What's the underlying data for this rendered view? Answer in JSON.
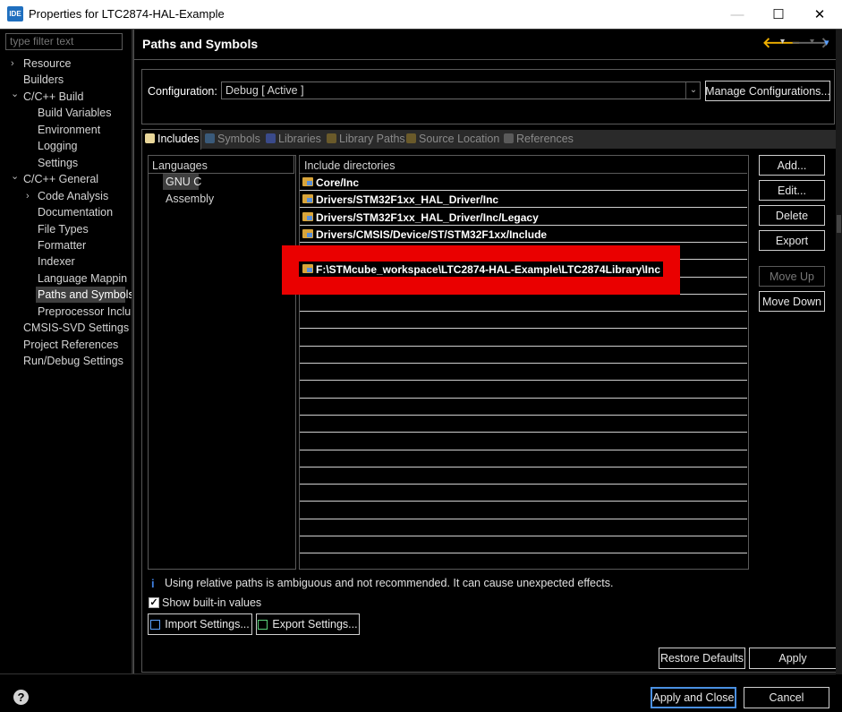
{
  "window": {
    "app_icon_text": "IDE",
    "title": "Properties for LTC2874-HAL-Example",
    "minimize": "—",
    "maximize": "☐",
    "close": "✕"
  },
  "sidebar": {
    "filter_placeholder": "type filter text",
    "items": [
      {
        "label": "Resource",
        "arrow": "›"
      },
      {
        "label": "Builders",
        "arrow": ""
      },
      {
        "label": "C/C++ Build",
        "arrow": "⌄"
      },
      {
        "label": "Build Variables",
        "arrow": ""
      },
      {
        "label": "Environment",
        "arrow": ""
      },
      {
        "label": "Logging",
        "arrow": ""
      },
      {
        "label": "Settings",
        "arrow": ""
      },
      {
        "label": "C/C++ General",
        "arrow": "⌄"
      },
      {
        "label": "Code Analysis",
        "arrow": "›"
      },
      {
        "label": "Documentation",
        "arrow": ""
      },
      {
        "label": "File Types",
        "arrow": ""
      },
      {
        "label": "Formatter",
        "arrow": ""
      },
      {
        "label": "Indexer",
        "arrow": ""
      },
      {
        "label": "Language Mappin",
        "arrow": ""
      },
      {
        "label": "Paths and Symbols",
        "arrow": ""
      },
      {
        "label": "Preprocessor Inclu",
        "arrow": ""
      },
      {
        "label": "CMSIS-SVD Settings",
        "arrow": ""
      },
      {
        "label": "Project References",
        "arrow": ""
      },
      {
        "label": "Run/Debug Settings",
        "arrow": ""
      }
    ],
    "selected": "Paths and Symbols"
  },
  "header": {
    "title": "Paths and Symbols",
    "back_icon": "🡐",
    "forward_icon": "🡒",
    "dropdown_icon": "▾"
  },
  "configuration": {
    "label": "Configuration:",
    "value": "Debug  [ Active ]",
    "manage_button": "Manage Configurations..."
  },
  "tabs": [
    {
      "label": "Includes",
      "active": true
    },
    {
      "label": "Symbols",
      "active": false
    },
    {
      "label": "Libraries",
      "active": false
    },
    {
      "label": "Library Paths",
      "active": false
    },
    {
      "label": "Source Location",
      "active": false
    },
    {
      "label": "References",
      "active": false
    }
  ],
  "languages": {
    "header": "Languages",
    "items": [
      "GNU C",
      "Assembly"
    ],
    "selected": "GNU C"
  },
  "includes": {
    "header": "Include directories",
    "items": [
      "Core/Inc",
      "Drivers/STM32F1xx_HAL_Driver/Inc",
      "Drivers/STM32F1xx_HAL_Driver/Inc/Legacy",
      "Drivers/CMSIS/Device/ST/STM32F1xx/Include",
      "",
      "F:\\STMcube_workspace\\LTC2874-HAL-Example\\LTC2874Library\\Inc"
    ],
    "highlight_color": "#ea0000"
  },
  "side_buttons": {
    "add": "Add...",
    "edit": "Edit...",
    "delete": "Delete",
    "export": "Export",
    "move_up": "Move Up",
    "move_down": "Move Down"
  },
  "info": {
    "icon": "i",
    "text": "Using relative paths is ambiguous and not recommended. It can cause unexpected effects."
  },
  "show_builtin": {
    "label": "Show built-in values",
    "checked": true
  },
  "import_settings": "Import Settings...",
  "export_settings": "Export Settings...",
  "restore_defaults": "Restore Defaults",
  "apply": "Apply",
  "apply_and_close": "Apply and Close",
  "cancel": "Cancel",
  "help_icon": "?"
}
